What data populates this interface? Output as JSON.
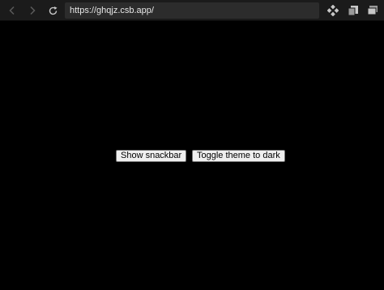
{
  "browser": {
    "url": "https://ghqjz.csb.app/",
    "icons": {
      "back": "back-arrow-icon",
      "forward": "forward-arrow-icon",
      "reload": "reload-icon",
      "tool1": "codesandbox-icon",
      "tool2": "open-in-new-window-icon",
      "tool3": "devtools-icon"
    }
  },
  "page": {
    "show_snackbar_label": "Show snackbar",
    "toggle_theme_label": "Toggle theme to dark",
    "background": "#000000"
  }
}
